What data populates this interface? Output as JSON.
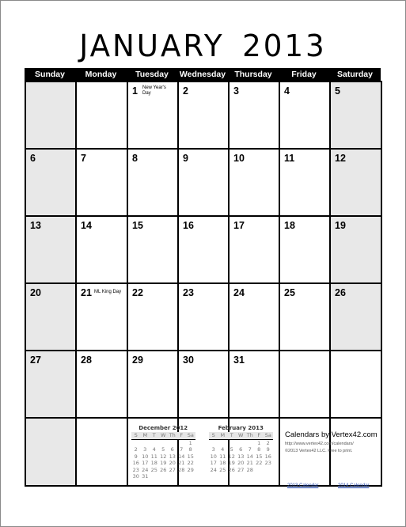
{
  "title": "JANUARY 2013",
  "weekdays": [
    "Sunday",
    "Monday",
    "Tuesday",
    "Wednesday",
    "Thursday",
    "Friday",
    "Saturday"
  ],
  "weeks": [
    [
      "",
      "",
      "1",
      "2",
      "3",
      "4",
      "5"
    ],
    [
      "6",
      "7",
      "8",
      "9",
      "10",
      "11",
      "12"
    ],
    [
      "13",
      "14",
      "15",
      "16",
      "17",
      "18",
      "19"
    ],
    [
      "20",
      "21",
      "22",
      "23",
      "24",
      "25",
      "26"
    ],
    [
      "27",
      "28",
      "29",
      "30",
      "31",
      "",
      ""
    ],
    [
      "",
      "",
      "",
      "",
      "",
      "",
      ""
    ]
  ],
  "holidays": [
    {
      "day": "1",
      "label": "New Year's Day"
    },
    {
      "day": "21",
      "label": "ML King Day"
    }
  ],
  "mini_calendars": [
    {
      "title": "December 2012",
      "headers": [
        "S",
        "M",
        "T",
        "W",
        "Th",
        "F",
        "Sa"
      ],
      "weeks": [
        [
          "",
          "",
          "",
          "",
          "",
          "",
          "1"
        ],
        [
          "2",
          "3",
          "4",
          "5",
          "6",
          "7",
          "8"
        ],
        [
          "9",
          "10",
          "11",
          "12",
          "13",
          "14",
          "15"
        ],
        [
          "16",
          "17",
          "18",
          "19",
          "20",
          "21",
          "22"
        ],
        [
          "23",
          "24",
          "25",
          "26",
          "27",
          "28",
          "29"
        ],
        [
          "30",
          "31",
          "",
          "",
          "",
          "",
          ""
        ]
      ]
    },
    {
      "title": "February 2013",
      "headers": [
        "S",
        "M",
        "T",
        "W",
        "Th",
        "F",
        "Sa"
      ],
      "weeks": [
        [
          "",
          "",
          "",
          "",
          "",
          "1",
          "2"
        ],
        [
          "3",
          "4",
          "5",
          "6",
          "7",
          "8",
          "9"
        ],
        [
          "10",
          "11",
          "12",
          "13",
          "14",
          "15",
          "16"
        ],
        [
          "17",
          "18",
          "19",
          "20",
          "21",
          "22",
          "23"
        ],
        [
          "24",
          "25",
          "26",
          "27",
          "28",
          "",
          ""
        ]
      ]
    }
  ],
  "footer": {
    "brand": "Calendars by Vertex42.com",
    "url": "http://www.vertex42.com/calendars/",
    "copyright": "©2013 Vertex42 LLC. Free to print.",
    "link1": "2013 Calendar",
    "link2": "2014 Calendar"
  }
}
